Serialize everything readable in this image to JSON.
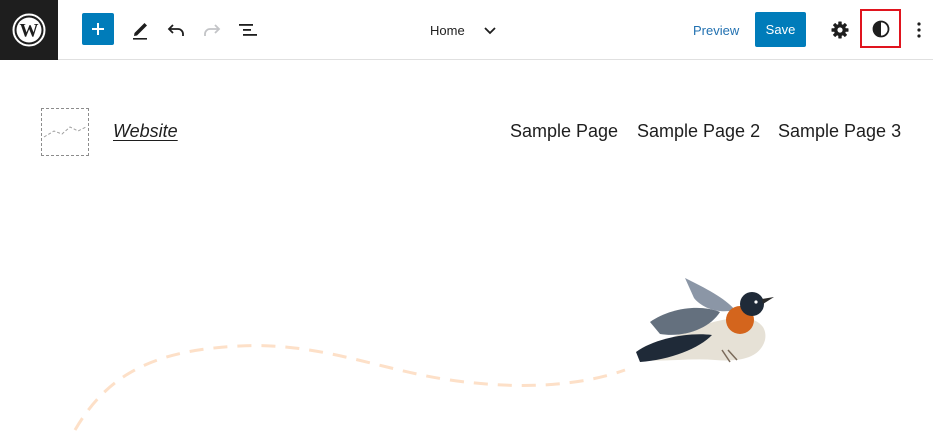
{
  "toolbar": {
    "document_title": "Home",
    "preview_label": "Preview",
    "save_label": "Save"
  },
  "site": {
    "title": "Website",
    "nav": [
      "Sample Page",
      "Sample Page 2",
      "Sample Page 3"
    ]
  },
  "colors": {
    "accent": "#007cba",
    "dark": "#1e1e1e",
    "highlight": "#e0141e",
    "dashed_path": "#fde0c8"
  },
  "icons": [
    "wordpress-icon",
    "plus-icon",
    "pencil-icon",
    "undo-icon",
    "redo-icon",
    "list-view-icon",
    "chevron-down-icon",
    "gear-icon",
    "half-circle-icon",
    "more-vertical-icon"
  ]
}
